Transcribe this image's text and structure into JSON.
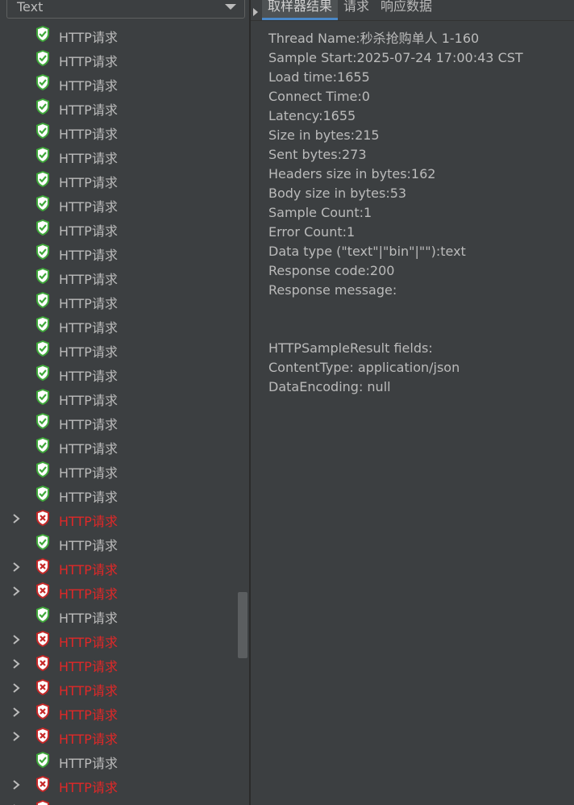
{
  "renderer_select": {
    "value": "Text"
  },
  "tree": {
    "items": [
      {
        "label": "HTTP请求",
        "status": "ok",
        "expandable": false
      },
      {
        "label": "HTTP请求",
        "status": "ok",
        "expandable": false
      },
      {
        "label": "HTTP请求",
        "status": "ok",
        "expandable": false
      },
      {
        "label": "HTTP请求",
        "status": "ok",
        "expandable": false
      },
      {
        "label": "HTTP请求",
        "status": "ok",
        "expandable": false
      },
      {
        "label": "HTTP请求",
        "status": "ok",
        "expandable": false
      },
      {
        "label": "HTTP请求",
        "status": "ok",
        "expandable": false
      },
      {
        "label": "HTTP请求",
        "status": "ok",
        "expandable": false
      },
      {
        "label": "HTTP请求",
        "status": "ok",
        "expandable": false
      },
      {
        "label": "HTTP请求",
        "status": "ok",
        "expandable": false
      },
      {
        "label": "HTTP请求",
        "status": "ok",
        "expandable": false
      },
      {
        "label": "HTTP请求",
        "status": "ok",
        "expandable": false
      },
      {
        "label": "HTTP请求",
        "status": "ok",
        "expandable": false
      },
      {
        "label": "HTTP请求",
        "status": "ok",
        "expandable": false
      },
      {
        "label": "HTTP请求",
        "status": "ok",
        "expandable": false
      },
      {
        "label": "HTTP请求",
        "status": "ok",
        "expandable": false
      },
      {
        "label": "HTTP请求",
        "status": "ok",
        "expandable": false
      },
      {
        "label": "HTTP请求",
        "status": "ok",
        "expandable": false
      },
      {
        "label": "HTTP请求",
        "status": "ok",
        "expandable": false
      },
      {
        "label": "HTTP请求",
        "status": "ok",
        "expandable": false
      },
      {
        "label": "HTTP请求",
        "status": "err",
        "expandable": true
      },
      {
        "label": "HTTP请求",
        "status": "ok",
        "expandable": false
      },
      {
        "label": "HTTP请求",
        "status": "err",
        "expandable": true
      },
      {
        "label": "HTTP请求",
        "status": "err",
        "expandable": true
      },
      {
        "label": "HTTP请求",
        "status": "ok",
        "expandable": false
      },
      {
        "label": "HTTP请求",
        "status": "err",
        "expandable": true
      },
      {
        "label": "HTTP请求",
        "status": "err",
        "expandable": true
      },
      {
        "label": "HTTP请求",
        "status": "err",
        "expandable": true
      },
      {
        "label": "HTTP请求",
        "status": "err",
        "expandable": true
      },
      {
        "label": "HTTP请求",
        "status": "err",
        "expandable": true
      },
      {
        "label": "HTTP请求",
        "status": "ok",
        "expandable": false
      },
      {
        "label": "HTTP请求",
        "status": "err",
        "expandable": true
      },
      {
        "label": "HTTP请求",
        "status": "err",
        "expandable": true
      }
    ]
  },
  "tabs": [
    {
      "label": "取样器结果",
      "active": true
    },
    {
      "label": "请求",
      "active": false
    },
    {
      "label": "响应数据",
      "active": false
    }
  ],
  "detail": {
    "lines": [
      "Thread Name:秒杀抢购单人 1-160",
      "Sample Start:2025-07-24 17:00:43 CST",
      "Load time:1655",
      "Connect Time:0",
      "Latency:1655",
      "Size in bytes:215",
      "Sent bytes:273",
      "Headers size in bytes:162",
      "Body size in bytes:53",
      "Sample Count:1",
      "Error Count:1",
      "Data type (\"text\"|\"bin\"|\"\"):text",
      "Response code:200",
      "Response message:",
      "",
      "",
      "HTTPSampleResult fields:",
      "ContentType: application/json",
      "DataEncoding: null"
    ]
  },
  "colors": {
    "ok_icon": "#3fa83a",
    "err_icon": "#c62828",
    "err_text": "#e02828",
    "tab_accent": "#4a88c7"
  }
}
